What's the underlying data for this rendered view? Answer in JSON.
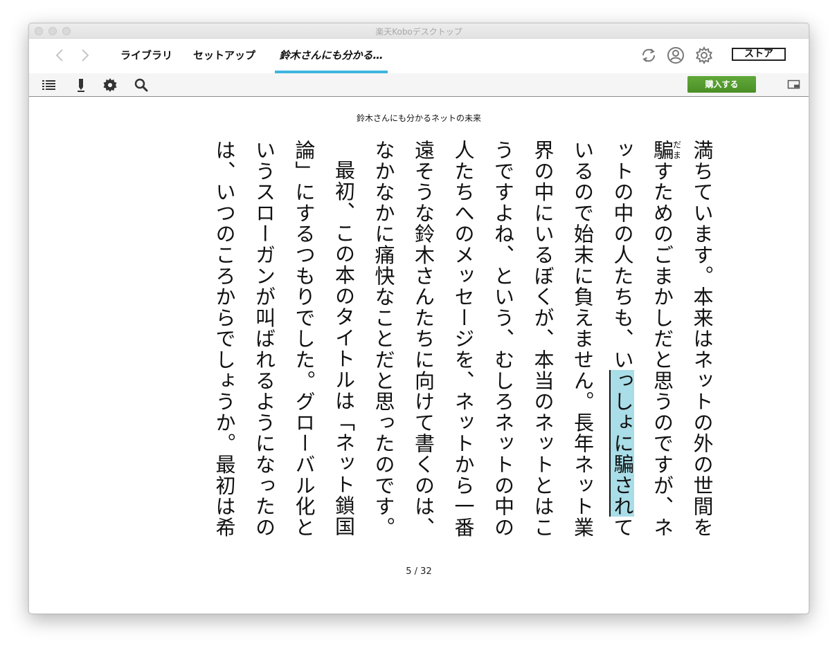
{
  "window": {
    "title": "楽天Koboデスクトップ"
  },
  "nav": {
    "back_icon": "chevron-left-icon",
    "forward_icon": "chevron-right-icon",
    "tabs": [
      {
        "label": "ライブラリ",
        "active": false
      },
      {
        "label": "セットアップ",
        "active": false
      },
      {
        "label": "鈴木さんにも分かる…",
        "active": true
      }
    ],
    "store_label": "ストア",
    "icons": [
      "sync-icon",
      "account-icon",
      "gear-icon"
    ]
  },
  "toolbar": {
    "icons": [
      "toc-list-icon",
      "pen-icon",
      "gear-icon",
      "search-icon",
      "layout-icon"
    ],
    "buy_label": "購入する",
    "buy_color": "#55992e"
  },
  "reader": {
    "book_title": "鈴木さんにも分かるネットの未来",
    "p1_a": "満ちています。本来はネットの外の世間を",
    "ruby_base": "騙",
    "ruby_text": "だま",
    "p1_b": "すためのごまかしだと思うのですが、ネットの中の人たちも、い",
    "p1_hl": "っしょに騙され",
    "p1_c": "ているので始末に負えません。長年ネット業界の中にいるぼくが、本当のネットとはこうですよね、という、むしろネットの中の人たちへのメッセージを、ネットから一番遠そうな鈴木さんたちに向けて書くのは、なかなかに痛快なことだと思ったのです。",
    "p2": "最初、この本のタイトルは「ネット鎖国論」にするつもりでした。グローバル化というスローガンが叫ばれるようになったのは、いつのころからでしょうか。最初は希",
    "highlight_color": "#a9dde7",
    "page_indicator": "5 / 32"
  }
}
